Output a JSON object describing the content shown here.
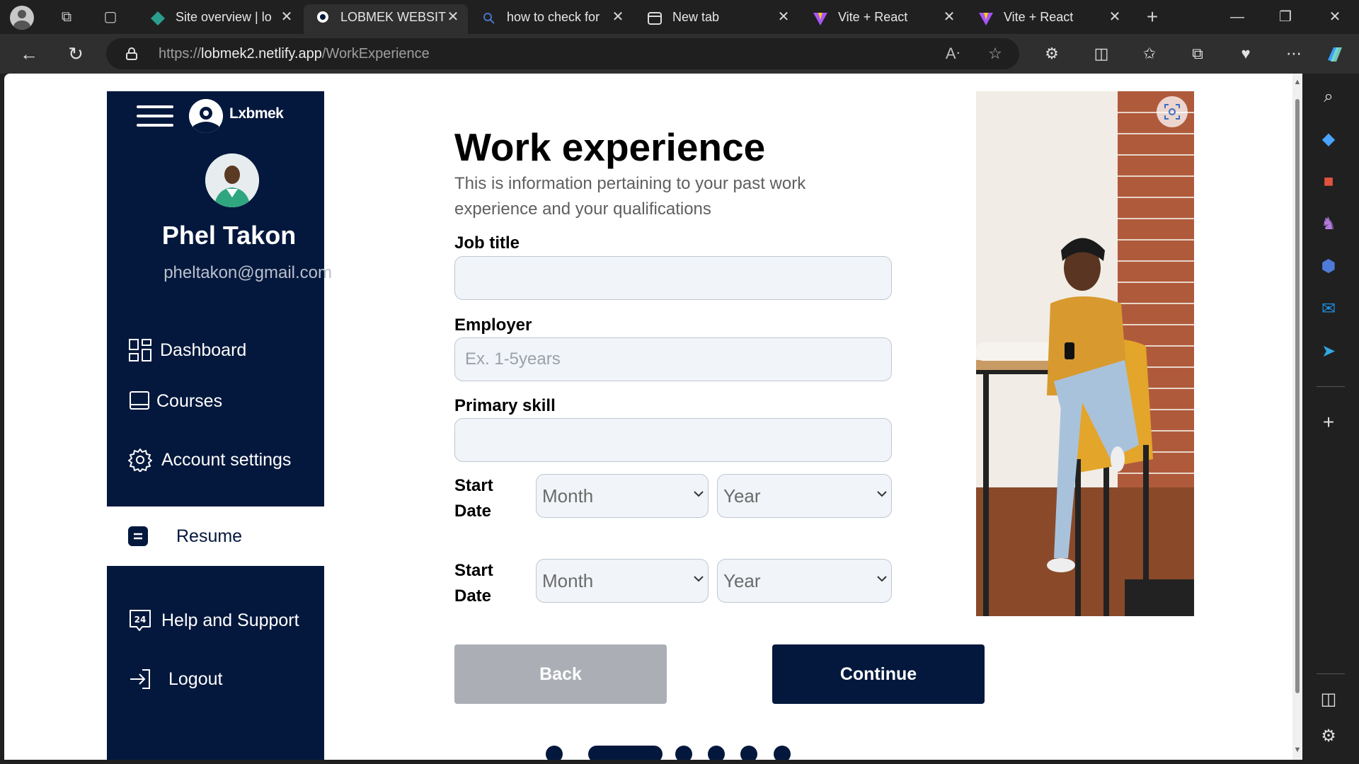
{
  "browser": {
    "tabs": [
      {
        "title": "Site overview | lo",
        "active": false
      },
      {
        "title": "LOBMEK WEBSITE",
        "active": true
      },
      {
        "title": "how to check for",
        "active": false
      },
      {
        "title": "New tab",
        "active": false
      },
      {
        "title": "Vite + React",
        "active": false
      },
      {
        "title": "Vite + React",
        "active": false
      }
    ],
    "url_scheme": "https://",
    "url_host": "lobmek2.netlify.app",
    "url_path": "/WorkExperience"
  },
  "sidebar": {
    "logo_text": "Lxbmek",
    "user_name": "Phel Takon",
    "user_email": "pheltakon@gmail.com",
    "items": [
      {
        "label": "Dashboard",
        "icon": "dashboard-icon"
      },
      {
        "label": "Courses",
        "icon": "book-icon"
      },
      {
        "label": "Account settings",
        "icon": "gear-icon"
      },
      {
        "label": "Resume",
        "icon": "resume-icon",
        "active": true
      },
      {
        "label": "Help and Support",
        "icon": "support-24-icon"
      },
      {
        "label": "Logout",
        "icon": "logout-icon"
      }
    ]
  },
  "form": {
    "title": "Work experience",
    "subtitle": "This is information pertaining to your past work experience and your qualifications",
    "job_title_label": "Job title",
    "job_title_value": "",
    "employer_label": "Employer",
    "employer_placeholder": "Ex. 1-5years",
    "primary_skill_label": "Primary skill",
    "primary_skill_value": "",
    "start_date_1": {
      "label_line1": "Start",
      "label_line2": "Date",
      "month": "Month",
      "year": "Year"
    },
    "start_date_2": {
      "label_line1": "Start",
      "label_line2": "Date",
      "month": "Month",
      "year": "Year"
    },
    "back_label": "Back",
    "continue_label": "Continue",
    "progress": {
      "steps": 6,
      "current_step": 2
    }
  },
  "colors": {
    "brand_navy": "#04183d",
    "back_button": "#abafb5",
    "input_bg": "#f1f4f8"
  }
}
